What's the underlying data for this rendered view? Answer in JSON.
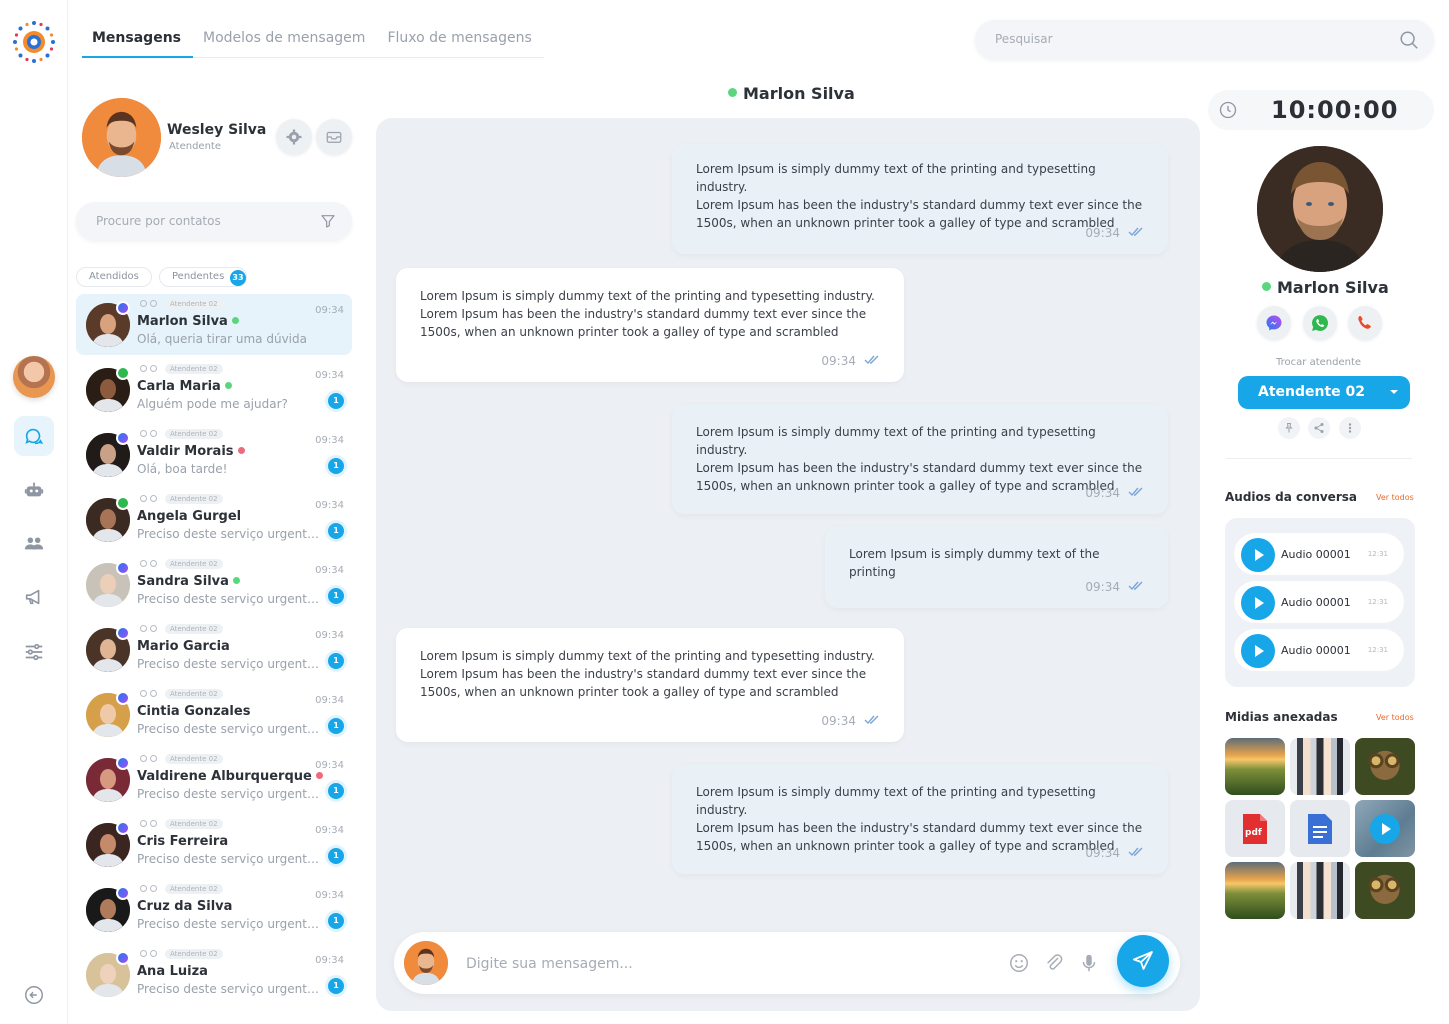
{
  "tabs": [
    {
      "label": "Mensagens",
      "active": true
    },
    {
      "label": "Modelos de mensagem",
      "active": false
    },
    {
      "label": "Fluxo de mensagens",
      "active": false
    }
  ],
  "search": {
    "placeholder": "Pesquisar"
  },
  "profile": {
    "name": "Wesley Silva",
    "role": "Atendente"
  },
  "contact_search": {
    "placeholder": "Procure por contatos"
  },
  "filters": {
    "attended": "Atendidos",
    "pending": "Pendentes",
    "pending_count": "33"
  },
  "contacts": [
    {
      "name": "Marlon Silva",
      "preview": "Olá, queria tirar uma dúvida",
      "time": "09:34",
      "tag": "Atendente 02",
      "status": "online",
      "channel": "messenger",
      "unread": ""
    },
    {
      "name": "Carla Maria",
      "preview": "Alguém pode me ajudar?",
      "time": "09:34",
      "tag": "Atendente 02",
      "status": "online",
      "channel": "whatsapp",
      "unread": "1"
    },
    {
      "name": "Valdir Morais",
      "preview": "Olá, boa tarde!",
      "time": "09:34",
      "tag": "Atendente 02",
      "status": "offline",
      "channel": "messenger",
      "unread": "1"
    },
    {
      "name": "Angela Gurgel",
      "preview": "Preciso deste serviço urgente...",
      "time": "09:34",
      "tag": "Atendente 02",
      "status": "none",
      "channel": "whatsapp",
      "unread": "1"
    },
    {
      "name": "Sandra Silva",
      "preview": "Preciso deste serviço urgente...",
      "time": "09:34",
      "tag": "Atendente 02",
      "status": "online",
      "channel": "messenger",
      "unread": "1"
    },
    {
      "name": "Mario Garcia",
      "preview": "Preciso deste serviço urgente...",
      "time": "09:34",
      "tag": "Atendente 02",
      "status": "none",
      "channel": "messenger",
      "unread": "1"
    },
    {
      "name": "Cintia  Gonzales",
      "preview": "Preciso deste serviço urgente...",
      "time": "09:34",
      "tag": "Atendente 02",
      "status": "none",
      "channel": "messenger",
      "unread": "1"
    },
    {
      "name": "Valdirene Alburquerque",
      "preview": "Preciso deste serviço urgente...",
      "time": "09:34",
      "tag": "Atendente 02",
      "status": "offline",
      "channel": "messenger",
      "unread": "1"
    },
    {
      "name": "Cris Ferreira",
      "preview": "Preciso deste serviço urgente...",
      "time": "09:34",
      "tag": "Atendente 02",
      "status": "none",
      "channel": "messenger",
      "unread": "1"
    },
    {
      "name": "Cruz da Silva",
      "preview": "Preciso deste serviço urgente...",
      "time": "09:34",
      "tag": "Atendente 02",
      "status": "none",
      "channel": "messenger",
      "unread": "1"
    },
    {
      "name": "Ana Luiza",
      "preview": "Preciso deste serviço urgente...",
      "time": "09:34",
      "tag": "Atendente 02",
      "status": "none",
      "channel": "messenger",
      "unread": "1"
    }
  ],
  "chat": {
    "contact_name": "Marlon Silva",
    "messages": [
      {
        "direction": "out",
        "lines": [
          "Lorem Ipsum is simply dummy text of the printing and typesetting industry.",
          "Lorem Ipsum has been the industry's standard dummy text ever since the",
          "1500s, when an unknown printer took a galley of type and scrambled"
        ],
        "time": "09:34"
      },
      {
        "direction": "in",
        "lines": [
          "Lorem Ipsum is simply dummy text of the printing and typesetting industry.",
          "Lorem Ipsum has been the industry's standard dummy text ever since the",
          "1500s, when an unknown printer took a galley of type and scrambled"
        ],
        "time": "09:34"
      },
      {
        "direction": "out",
        "lines": [
          "Lorem Ipsum is simply dummy text of the printing and typesetting industry.",
          "Lorem Ipsum has been the industry's standard dummy text ever since the",
          "1500s, when an unknown printer took a galley of type and scrambled"
        ],
        "time": "09:34"
      },
      {
        "direction": "out",
        "lines": [
          "Lorem Ipsum is simply dummy text of the printing"
        ],
        "time": "09:34"
      },
      {
        "direction": "in",
        "lines": [
          "Lorem Ipsum is simply dummy text of the printing and typesetting industry.",
          "Lorem Ipsum has been the industry's standard dummy text ever since the",
          "1500s, when an unknown printer took a galley of type and scrambled"
        ],
        "time": "09:34"
      },
      {
        "direction": "out",
        "lines": [
          "Lorem Ipsum is simply dummy text of the printing and typesetting industry.",
          "Lorem Ipsum has been the industry's standard dummy text ever since the",
          "1500s, when an unknown printer took a galley of type and scrambled"
        ],
        "time": "09:34"
      }
    ],
    "composer_placeholder": "Digite sua mensagem..."
  },
  "right_panel": {
    "timer": "10:00:00",
    "contact_name": "Marlon Silva",
    "change_agent_label": "Trocar atendente",
    "selected_agent": "Atendente 02",
    "audios_title": "Audios da conversa",
    "see_all": "Ver todos",
    "audios": [
      {
        "label": "Audio 00001",
        "duration": "12:31"
      },
      {
        "label": "Audio 00001",
        "duration": "12:31"
      },
      {
        "label": "Audio 00001",
        "duration": "12:31"
      }
    ],
    "media_title": "Midias anexadas",
    "pdf_label": "pdf",
    "media": [
      "landscape-image",
      "call-center-image",
      "owl-image",
      "pdf-file",
      "doc-file",
      "video-file",
      "landscape-image",
      "call-center-image",
      "owl-image"
    ]
  },
  "colors": {
    "accent": "#17a6e8",
    "online": "#5ad67d",
    "offline": "#ee6a7e",
    "link": "#e86a2d"
  }
}
